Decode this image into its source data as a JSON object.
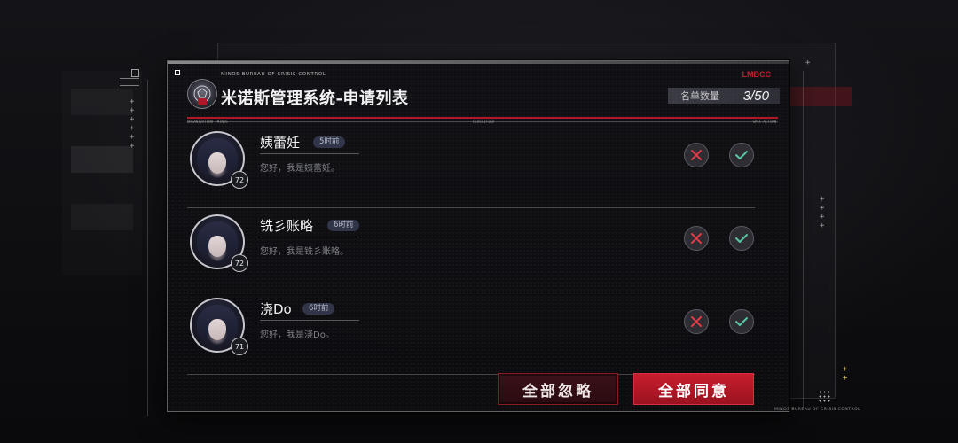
{
  "header": {
    "org_name": "MINOS BUREAU OF CRISIS CONTROL",
    "title": "米诺斯管理系统-申请列表",
    "corner_tag": "LMBCC",
    "count_label": "名单数量",
    "count_value": "3/50",
    "micro_left": "ORGANIZATION ·MINOS",
    "micro_mid": "CLASSIFIED",
    "micro_right": "SPEC·ACTION"
  },
  "requests": [
    {
      "name": "姨蕾妊",
      "time": "5时前",
      "greeting": "您好，我是姨蕾妊。",
      "level": "72"
    },
    {
      "name": "铣彡账略",
      "time": "6时前",
      "greeting": "您好，我是铣彡账略。",
      "level": "72"
    },
    {
      "name": "浇Do",
      "time": "6时前",
      "greeting": "您好，我是浇Do。",
      "level": "71"
    }
  ],
  "actions": {
    "ignore_all": "全部忽略",
    "accept_all": "全部同意"
  },
  "footer": {
    "org_name": "MINOS BUREAU OF CRISIS CONTROL"
  },
  "colors": {
    "accent_red": "#c81e2e",
    "reject_icon": "#e03a44",
    "accept_icon": "#58c6a2"
  },
  "icons": {
    "reject": "close-icon",
    "accept": "check-icon",
    "logo": "bureau-emblem-icon"
  }
}
